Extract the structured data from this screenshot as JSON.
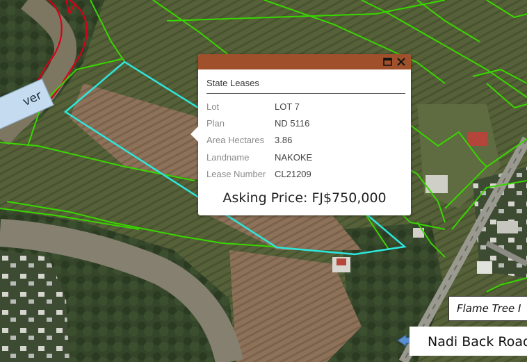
{
  "map": {
    "river_label": "ver",
    "road_label": "Nadi Back Road",
    "place_label": "Flame Tree I",
    "parcel_color": "#39d600",
    "selected_parcel_color": "#2ee6dd",
    "river_boundary_color": "#d8001a"
  },
  "popup": {
    "header_color": "#a0502a",
    "maximize_icon": "maximize-icon",
    "close_icon": "close-icon",
    "title": "State Leases",
    "fields": [
      {
        "key": "Lot",
        "value": "LOT 7"
      },
      {
        "key": "Plan",
        "value": "ND 5116"
      },
      {
        "key": "Area Hectares",
        "value": "3.86"
      },
      {
        "key": "Landname",
        "value": "NAKOKE"
      },
      {
        "key": "Lease Number",
        "value": "CL21209"
      }
    ],
    "asking_price": "Asking Price: FJ$750,000"
  }
}
